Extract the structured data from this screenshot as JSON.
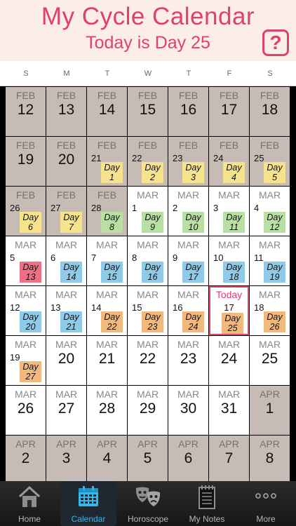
{
  "header": {
    "title": "My Cycle Calendar",
    "subtitle": "Today is Day 25",
    "help_label": "?"
  },
  "weekdays": [
    "S",
    "M",
    "T",
    "W",
    "T",
    "F",
    "S"
  ],
  "colors": {
    "accent": "#e0406c",
    "out_of_month": "#c7bcb5",
    "badge_yellow": "#f7e38e",
    "badge_green": "#b9dfa4",
    "badge_red": "#ef6f84",
    "badge_blue": "#8fcbe8",
    "badge_orange": "#f2b97e",
    "tab_active": "#38b6e8"
  },
  "today_label": "Today",
  "calendar": [
    [
      {
        "m": "FEB",
        "d": "12",
        "out": true
      },
      {
        "m": "FEB",
        "d": "13",
        "out": true
      },
      {
        "m": "FEB",
        "d": "14",
        "out": true
      },
      {
        "m": "FEB",
        "d": "15",
        "out": true
      },
      {
        "m": "FEB",
        "d": "16",
        "out": true
      },
      {
        "m": "FEB",
        "d": "17",
        "out": true
      },
      {
        "m": "FEB",
        "d": "18",
        "out": true
      }
    ],
    [
      {
        "m": "FEB",
        "d": "19",
        "out": true
      },
      {
        "m": "FEB",
        "d": "20",
        "out": true
      },
      {
        "m": "FEB",
        "d": "21",
        "out": true,
        "day": "Day",
        "n": "1",
        "c": "yellow"
      },
      {
        "m": "FEB",
        "d": "22",
        "out": true,
        "day": "Day",
        "n": "2",
        "c": "yellow"
      },
      {
        "m": "FEB",
        "d": "23",
        "out": true,
        "day": "Day",
        "n": "3",
        "c": "yellow"
      },
      {
        "m": "FEB",
        "d": "24",
        "out": true,
        "day": "Day",
        "n": "4",
        "c": "yellow"
      },
      {
        "m": "FEB",
        "d": "25",
        "out": true,
        "day": "Day",
        "n": "5",
        "c": "yellow"
      }
    ],
    [
      {
        "m": "FEB",
        "d": "26",
        "out": true,
        "day": "Day",
        "n": "6",
        "c": "yellow"
      },
      {
        "m": "FEB",
        "d": "27",
        "out": true,
        "day": "Day",
        "n": "7",
        "c": "yellow"
      },
      {
        "m": "FEB",
        "d": "28",
        "out": true,
        "day": "Day",
        "n": "8",
        "c": "green"
      },
      {
        "m": "MAR",
        "d": "1",
        "day": "Day",
        "n": "9",
        "c": "green"
      },
      {
        "m": "MAR",
        "d": "2",
        "day": "Day",
        "n": "10",
        "c": "green"
      },
      {
        "m": "MAR",
        "d": "3",
        "day": "Day",
        "n": "11",
        "c": "green"
      },
      {
        "m": "MAR",
        "d": "4",
        "day": "Day",
        "n": "12",
        "c": "green"
      }
    ],
    [
      {
        "m": "MAR",
        "d": "5",
        "day": "Day",
        "n": "13",
        "c": "red"
      },
      {
        "m": "MAR",
        "d": "6",
        "day": "Day",
        "n": "14",
        "c": "blue"
      },
      {
        "m": "MAR",
        "d": "7",
        "day": "Day",
        "n": "15",
        "c": "blue"
      },
      {
        "m": "MAR",
        "d": "8",
        "day": "Day",
        "n": "16",
        "c": "blue"
      },
      {
        "m": "MAR",
        "d": "9",
        "day": "Day",
        "n": "17",
        "c": "blue"
      },
      {
        "m": "MAR",
        "d": "10",
        "day": "Day",
        "n": "18",
        "c": "blue"
      },
      {
        "m": "MAR",
        "d": "11",
        "day": "Day",
        "n": "19",
        "c": "blue"
      }
    ],
    [
      {
        "m": "MAR",
        "d": "12",
        "day": "Day",
        "n": "20",
        "c": "blue"
      },
      {
        "m": "MAR",
        "d": "13",
        "day": "Day",
        "n": "21",
        "c": "blue"
      },
      {
        "m": "MAR",
        "d": "14",
        "day": "Day",
        "n": "22",
        "c": "orange"
      },
      {
        "m": "MAR",
        "d": "15",
        "day": "Day",
        "n": "23",
        "c": "orange"
      },
      {
        "m": "MAR",
        "d": "16",
        "day": "Day",
        "n": "24",
        "c": "orange"
      },
      {
        "m": "",
        "d": "17",
        "today": true,
        "day": "Day",
        "n": "25",
        "c": "orange"
      },
      {
        "m": "MAR",
        "d": "18",
        "day": "Day",
        "n": "26",
        "c": "orange"
      }
    ],
    [
      {
        "m": "MAR",
        "d": "19",
        "day": "Day",
        "n": "27",
        "c": "orange"
      },
      {
        "m": "MAR",
        "d": "20"
      },
      {
        "m": "MAR",
        "d": "21"
      },
      {
        "m": "MAR",
        "d": "22"
      },
      {
        "m": "MAR",
        "d": "23"
      },
      {
        "m": "MAR",
        "d": "24"
      },
      {
        "m": "MAR",
        "d": "25"
      }
    ],
    [
      {
        "m": "MAR",
        "d": "26"
      },
      {
        "m": "MAR",
        "d": "27"
      },
      {
        "m": "MAR",
        "d": "28"
      },
      {
        "m": "MAR",
        "d": "29"
      },
      {
        "m": "MAR",
        "d": "30"
      },
      {
        "m": "MAR",
        "d": "31"
      },
      {
        "m": "APR",
        "d": "1",
        "out": true
      }
    ],
    [
      {
        "m": "APR",
        "d": "2",
        "out": true
      },
      {
        "m": "APR",
        "d": "3",
        "out": true
      },
      {
        "m": "APR",
        "d": "4",
        "out": true
      },
      {
        "m": "APR",
        "d": "5",
        "out": true
      },
      {
        "m": "APR",
        "d": "6",
        "out": true
      },
      {
        "m": "APR",
        "d": "7",
        "out": true
      },
      {
        "m": "APR",
        "d": "8",
        "out": true
      }
    ]
  ],
  "tabs": [
    {
      "label": "Home",
      "icon": "home-icon"
    },
    {
      "label": "Calendar",
      "icon": "calendar-icon",
      "active": true
    },
    {
      "label": "Horoscope",
      "icon": "theater-masks-icon"
    },
    {
      "label": "My Notes",
      "icon": "notepad-icon"
    },
    {
      "label": "More",
      "icon": "more-dots-icon"
    }
  ]
}
